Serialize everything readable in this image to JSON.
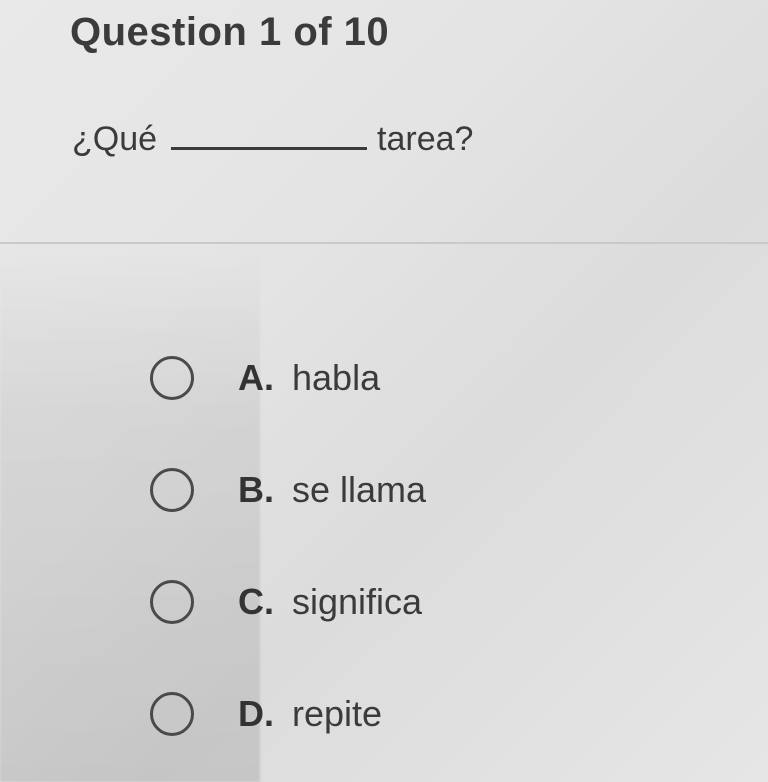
{
  "header": {
    "title": "Question 1 of 10"
  },
  "question": {
    "prefix": "¿Qué",
    "suffix": "tarea?"
  },
  "options": [
    {
      "letter": "A.",
      "text": "habla"
    },
    {
      "letter": "B.",
      "text": "se llama"
    },
    {
      "letter": "C.",
      "text": "significa"
    },
    {
      "letter": "D.",
      "text": "repite"
    }
  ]
}
